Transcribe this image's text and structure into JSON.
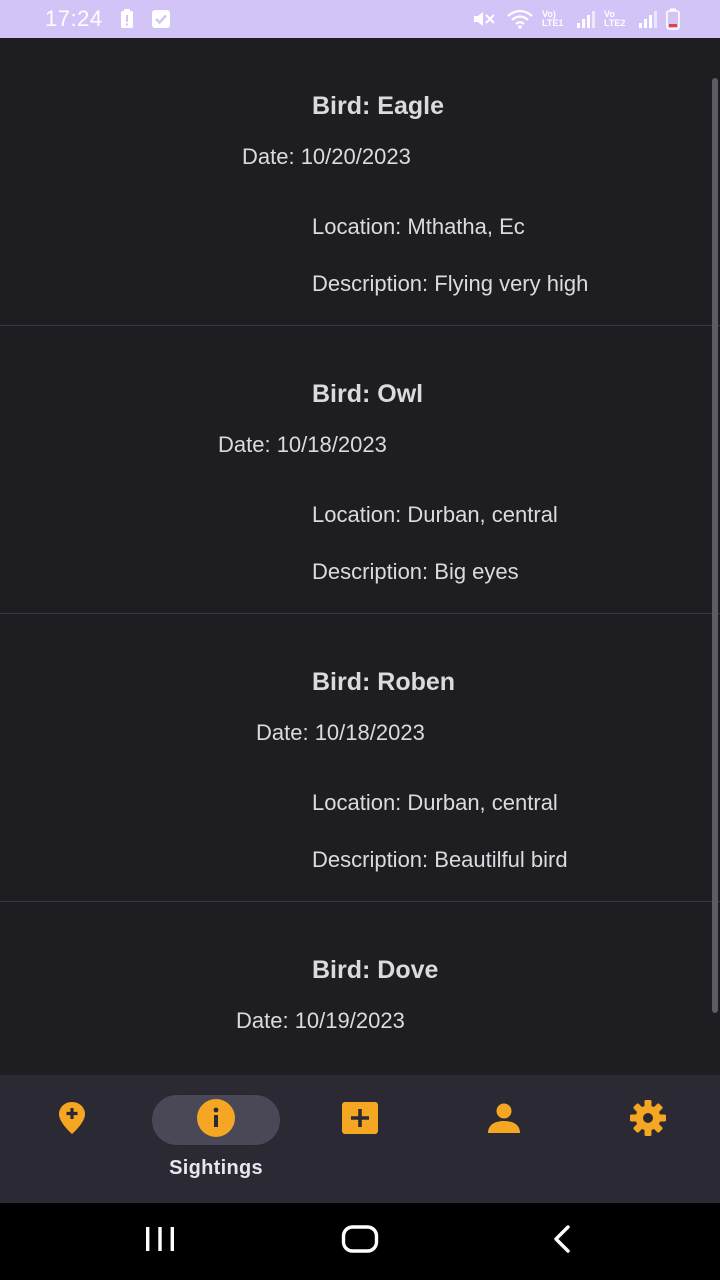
{
  "status_bar": {
    "time": "17:24",
    "network_1": "Vo) LTE1",
    "network_2": "Vo LTE2"
  },
  "sightings": [
    {
      "bird": "Bird: Eagle",
      "date": "Date: 10/20/2023",
      "location": "Location: Mthatha, Ec",
      "description": "Description: Flying very high"
    },
    {
      "bird": "Bird: Owl",
      "date": "Date: 10/18/2023",
      "location": "Location: Durban, central",
      "description": "Description: Big eyes"
    },
    {
      "bird": "Bird: Roben",
      "date": "Date: 10/18/2023",
      "location": "Location: Durban, central",
      "description": "Description: Beautilful bird"
    },
    {
      "bird": "Bird: Dove",
      "date": "Date: 10/19/2023",
      "location": "",
      "description": ""
    }
  ],
  "bottom_nav": {
    "items": [
      {
        "icon": "add-location-icon",
        "label": ""
      },
      {
        "icon": "info-icon",
        "label": "Sightings",
        "selected": true
      },
      {
        "icon": "add-box-icon",
        "label": ""
      },
      {
        "icon": "person-icon",
        "label": ""
      },
      {
        "icon": "settings-icon",
        "label": ""
      }
    ]
  },
  "colors": {
    "background": "#1e1e22",
    "status_bar": "#d2c4f7",
    "accent": "#f5a623",
    "nav_background": "#2b2933",
    "nav_pill": "#4a4856"
  }
}
